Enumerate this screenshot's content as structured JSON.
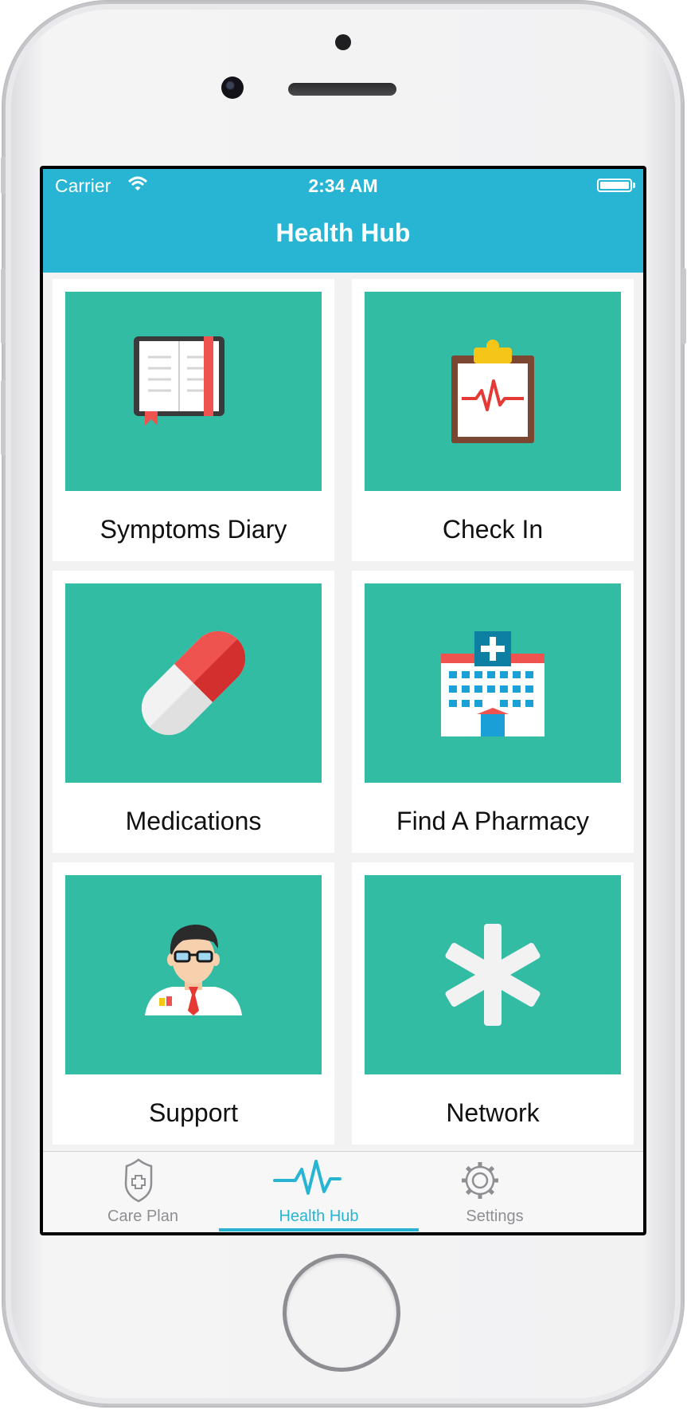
{
  "status_bar": {
    "carrier": "Carrier",
    "time": "2:34 AM"
  },
  "nav": {
    "title": "Health Hub"
  },
  "colors": {
    "accent": "#27b5d3",
    "tile": "#33bca4"
  },
  "cards": [
    {
      "label": "Symptoms Diary",
      "icon": "diary-book-icon"
    },
    {
      "label": "Check In",
      "icon": "clipboard-heartbeat-icon"
    },
    {
      "label": "Medications",
      "icon": "pill-capsule-icon"
    },
    {
      "label": "Find A Pharmacy",
      "icon": "hospital-building-icon"
    },
    {
      "label": "Support",
      "icon": "doctor-avatar-icon"
    },
    {
      "label": "Network",
      "icon": "asterisk-icon"
    }
  ],
  "tabs": [
    {
      "label": "Care Plan",
      "icon": "shield-plus-icon",
      "active": false
    },
    {
      "label": "Health Hub",
      "icon": "heartbeat-icon",
      "active": true
    },
    {
      "label": "Settings",
      "icon": "gear-icon",
      "active": false
    }
  ]
}
